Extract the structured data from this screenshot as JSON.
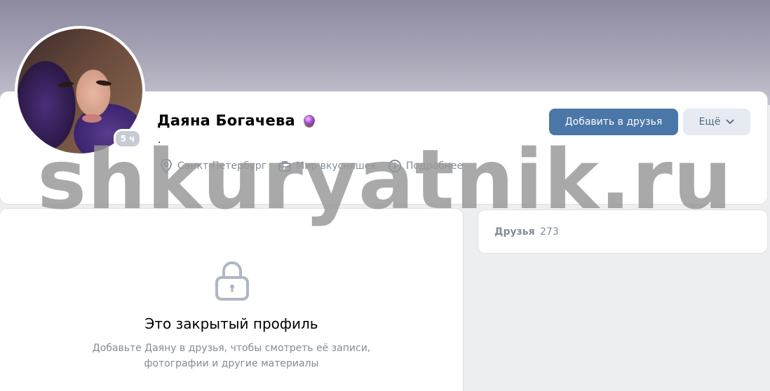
{
  "profile": {
    "name": "Даяна Богачева",
    "name_emoji": "crystal-ball-emoji",
    "status": ".",
    "online_badge": "5 ч",
    "city": "Санкт-Петербург",
    "job": "Мир вкусняшек",
    "more_info": "Подробнее"
  },
  "actions": {
    "add_friend": "Добавить в друзья",
    "more": "Ещё"
  },
  "closed_profile": {
    "title": "Это закрытый профиль",
    "description_line1": "Добавьте Даяну в друзья, чтобы смотреть её записи,",
    "description_line2": "фотографии и другие материалы"
  },
  "friends": {
    "label": "Друзья",
    "count": "273"
  },
  "watermark": "shkuryatnik.ru",
  "colors": {
    "primary_button": "#4a76a8",
    "secondary_button": "#e5ebf1",
    "muted_text": "#818c99",
    "page_background": "#edeef0"
  }
}
